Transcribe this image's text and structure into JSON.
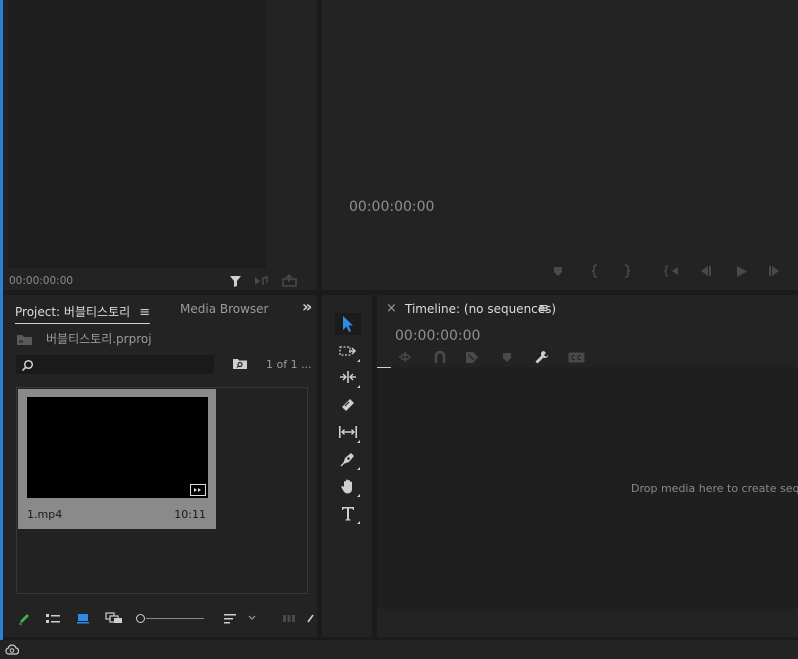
{
  "source_monitor": {
    "timecode": "00:00:00:00"
  },
  "program_monitor": {
    "timecode": "00:00:00:00"
  },
  "project_panel": {
    "tab_label": "Project: 버블티스토리",
    "menu_glyph": "≡",
    "media_browser_tab": "Media Browser",
    "overflow_glyph": "»",
    "project_file": "버블티스토리.prproj",
    "search_placeholder": "",
    "item_count": "1 of 1 ...",
    "clip": {
      "name": "1.mp4",
      "duration": "10:11"
    }
  },
  "timeline_panel": {
    "close_glyph": "×",
    "tab_label": "Timeline: (no sequences)",
    "menu_glyph": "≡",
    "timecode": "00:00:00:00",
    "drop_hint": "Drop media here to create sequence."
  },
  "colors": {
    "accent_blue": "#2d8ceb",
    "panel_bg": "#232323",
    "frame_bg": "#1b1b1b",
    "clip_bg": "#8a8a8a",
    "pencil_green": "#39b54a"
  }
}
